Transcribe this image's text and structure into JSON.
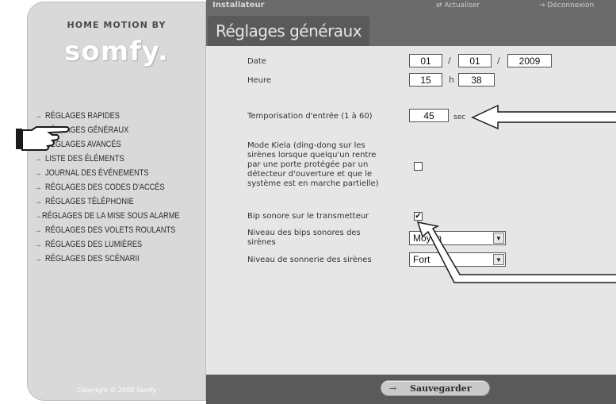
{
  "brand": {
    "tagline": "HOME MOTION BY",
    "logo": "somfy."
  },
  "topbar": {
    "user": "Installateur",
    "refresh": "Actualiser",
    "logout": "Déconnexion"
  },
  "page_title": "Réglages généraux",
  "menu": [
    {
      "label": "RÉGLAGES RAPIDES"
    },
    {
      "label": "RÉGLAGES GÉNÉRAUX"
    },
    {
      "label": "RÉGLAGES AVANCÉS"
    },
    {
      "label": "LISTE DES ÉLÉMENTS"
    },
    {
      "label": "JOURNAL DES ÉVÉNEMENTS"
    },
    {
      "label": "RÉGLAGES DES CODES D'ACCÈS"
    },
    {
      "label": "RÉGLAGES TÉLÉPHONIE"
    },
    {
      "label": "RÉGLAGES DE LA MISE SOUS ALARME"
    },
    {
      "label": "RÉGLAGES DES VOLETS ROULANTS"
    },
    {
      "label": "RÉGLAGES DES LUMIÈRES"
    },
    {
      "label": "RÉGLAGES DES SCÉNARII"
    }
  ],
  "copyright": "Copyright © 2008 Somfy",
  "form": {
    "date_label": "Date",
    "date_day": "01",
    "date_month": "01",
    "date_year": "2009",
    "date_sep": "/",
    "time_label": "Heure",
    "time_hour": "15",
    "time_sep": "h",
    "time_minute": "38",
    "entry_delay_label": "Temporisation d'entrée (1 à 60)",
    "entry_delay_value": "45",
    "entry_delay_unit": "sec",
    "kiela_label_lines": [
      "Mode Kiela (ding-dong sur les",
      "sirènes lorsque quelqu'un rentre",
      "par une porte protégée par un",
      "détecteur d'ouverture et que le",
      "système est en marche partielle)"
    ],
    "kiela_checked": false,
    "bip_label": "Bip sonore sur le transmetteur",
    "bip_checked": true,
    "bip_level_label_lines": [
      "Niveau des bips sonores des",
      "sirènes"
    ],
    "bip_level_value": "Moyen",
    "ring_level_label": "Niveau de sonnerie des sirènes",
    "ring_level_value": "Fort"
  },
  "footer": {
    "save_label": "Sauvegarder"
  },
  "colors": {
    "sidebar_bg": "#d9d9d9",
    "header_bg": "#6b6b6b",
    "content_bg": "#e6e6e6",
    "footer_bg": "#5a5a5a"
  }
}
